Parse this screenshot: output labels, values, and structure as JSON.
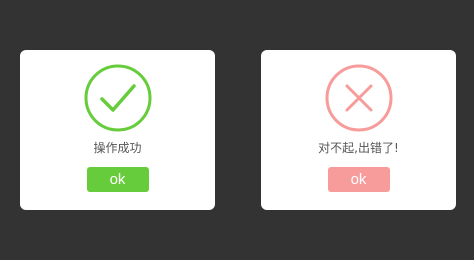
{
  "success_dialog": {
    "message": "操作成功",
    "button_label": "ok",
    "icon": "checkmark-circle-icon",
    "accent_color": "#66cc3b"
  },
  "error_dialog": {
    "message": "对不起,出错了!",
    "button_label": "ok",
    "icon": "x-circle-icon",
    "accent_color": "#f79b9b"
  }
}
